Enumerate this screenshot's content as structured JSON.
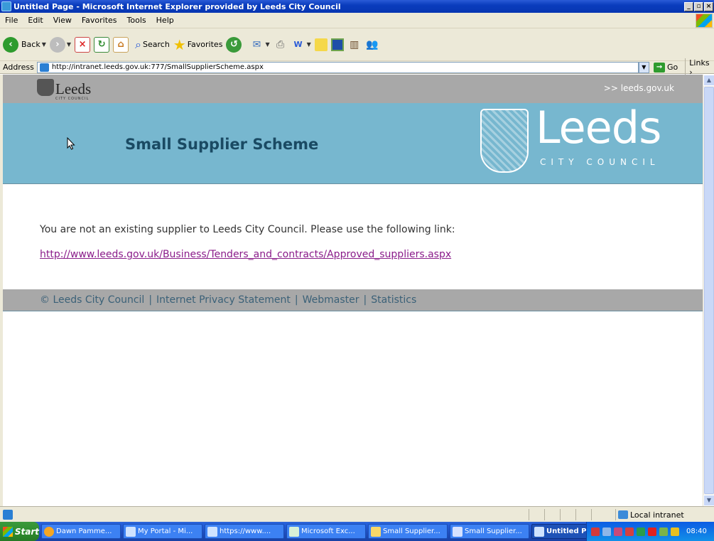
{
  "window": {
    "title": "Untitled Page - Microsoft Internet Explorer provided by Leeds City Council",
    "controls": [
      "_",
      "▫",
      "×"
    ]
  },
  "menu": [
    "File",
    "Edit",
    "View",
    "Favorites",
    "Tools",
    "Help"
  ],
  "toolbar": {
    "back_label": "Back",
    "search_label": "Search",
    "favorites_label": "Favorites"
  },
  "address": {
    "label": "Address",
    "url": "http://intranet.leeds.gov.uk:777/SmallSupplierScheme.aspx",
    "go_label": "Go",
    "links_label": "Links"
  },
  "page": {
    "logo_word": "Leeds",
    "logo_sub": "CITY COUNCIL",
    "top_link": ">> leeds.gov.uk",
    "banner_title": "Small Supplier Scheme",
    "big_logo_word": "Leeds",
    "big_logo_sub": "CITY COUNCIL",
    "message": "You are not an existing supplier to Leeds City Council. Please use the following link:",
    "link": "http://www.leeds.gov.uk/Business/Tenders_and_contracts/Approved_suppliers.aspx",
    "footer": {
      "copyright": "© Leeds City Council",
      "privacy": "Internet Privacy Statement",
      "webmaster": "Webmaster",
      "statistics": "Statistics",
      "separator": "|"
    }
  },
  "status": {
    "zone": "Local intranet"
  },
  "taskbar": {
    "start_label": "Start",
    "tasks": [
      "Dawn Pamme...",
      "My Portal - Mi...",
      "https://www....",
      "Microsoft Exc...",
      "Small Supplier...",
      "Small Supplier...",
      "Untitled Pag..."
    ],
    "clock": "08:40"
  }
}
